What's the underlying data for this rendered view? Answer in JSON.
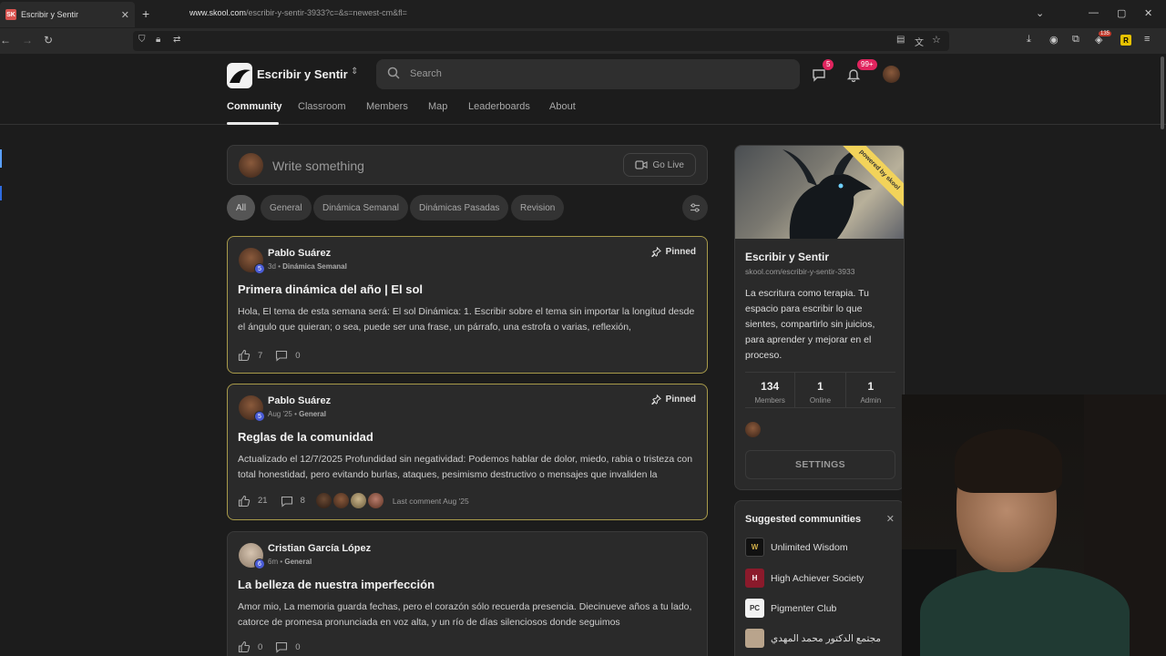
{
  "browser": {
    "tab_title": "Escribir y Sentir",
    "favicon_text": "SK",
    "url_host": "www.skool.com",
    "url_path": "/escribir-y-sentir-3933?c=&s=newest-cm&fl=",
    "ext_badge": "135",
    "ext_r_label": "R"
  },
  "header": {
    "brand": "Escribir y Sentir",
    "search_placeholder": "Search",
    "chat_badge": "5",
    "notif_badge": "99+",
    "nav": [
      "Community",
      "Classroom",
      "Members",
      "Map",
      "Leaderboards",
      "About"
    ]
  },
  "composer": {
    "placeholder": "Write something",
    "go_live": "Go Live"
  },
  "filters": [
    "All",
    "General",
    "Dinámica Semanal",
    "Dinámicas Pasadas",
    "Revision"
  ],
  "posts": [
    {
      "author": "Pablo Suárez",
      "level": "5",
      "time": "3d",
      "category": "Dinámica Semanal",
      "pinned_label": "Pinned",
      "title": "Primera dinámica del año | El sol",
      "body": "Hola, El tema de esta semana será: El sol Dinámica: 1. Escribir sobre el tema sin importar la longitud desde el ángulo que quieran; o sea, puede ser una frase, un párrafo, una estrofa o varias, reflexión,",
      "likes": "7",
      "comments": "0"
    },
    {
      "author": "Pablo Suárez",
      "level": "5",
      "time": "Aug '25",
      "category": "General",
      "pinned_label": "Pinned",
      "title": "Reglas de la comunidad",
      "body": "Actualizado el 12/7/2025 Profundidad sin negatividad: Podemos hablar de dolor, miedo, rabia o tristeza con total honestidad, pero evitando burlas, ataques, pesimismo destructivo o mensajes que invaliden la",
      "likes": "21",
      "comments": "8",
      "last_comment": "Last comment Aug '25"
    },
    {
      "author": "Cristian García López",
      "level": "6",
      "time": "6m",
      "category": "General",
      "title": "La belleza de nuestra imperfección",
      "body": "Amor mio, La memoria guarda fechas, pero el corazón sólo recuerda presencia. Diecinueve años a tu lado, catorce de promesa pronunciada en voz alta, y un río de días silenciosos donde seguimos",
      "likes": "0",
      "comments": "0"
    }
  ],
  "sidebar": {
    "ribbon": "powered by skool",
    "name": "Escribir y Sentir",
    "url": "skool.com/escribir-y-sentir-3933",
    "description": "La escritura como terapia. Tu espacio para escribir lo que sientes, compartirlo sin juicios, para aprender y mejorar en el proceso.",
    "stats": [
      {
        "value": "134",
        "label": "Members"
      },
      {
        "value": "1",
        "label": "Online"
      },
      {
        "value": "1",
        "label": "Admin"
      }
    ],
    "settings": "SETTINGS"
  },
  "suggested": {
    "title": "Suggested communities",
    "items": [
      {
        "name": "Unlimited Wisdom",
        "icon": "W",
        "color": "#111111"
      },
      {
        "name": "High Achiever Society",
        "icon": "H",
        "color": "#8b1a2b"
      },
      {
        "name": "Pigmenter Club",
        "icon": "PC",
        "color": "#f2f2f2"
      },
      {
        "name": "مجتمع الدكتور محمد المهدي",
        "icon": "",
        "color": "#b9a48c"
      }
    ]
  },
  "colors": {
    "accent_badge": "#e0245e",
    "pinned_border": "#a89a4a",
    "level_badge": "#4a5cd6"
  }
}
